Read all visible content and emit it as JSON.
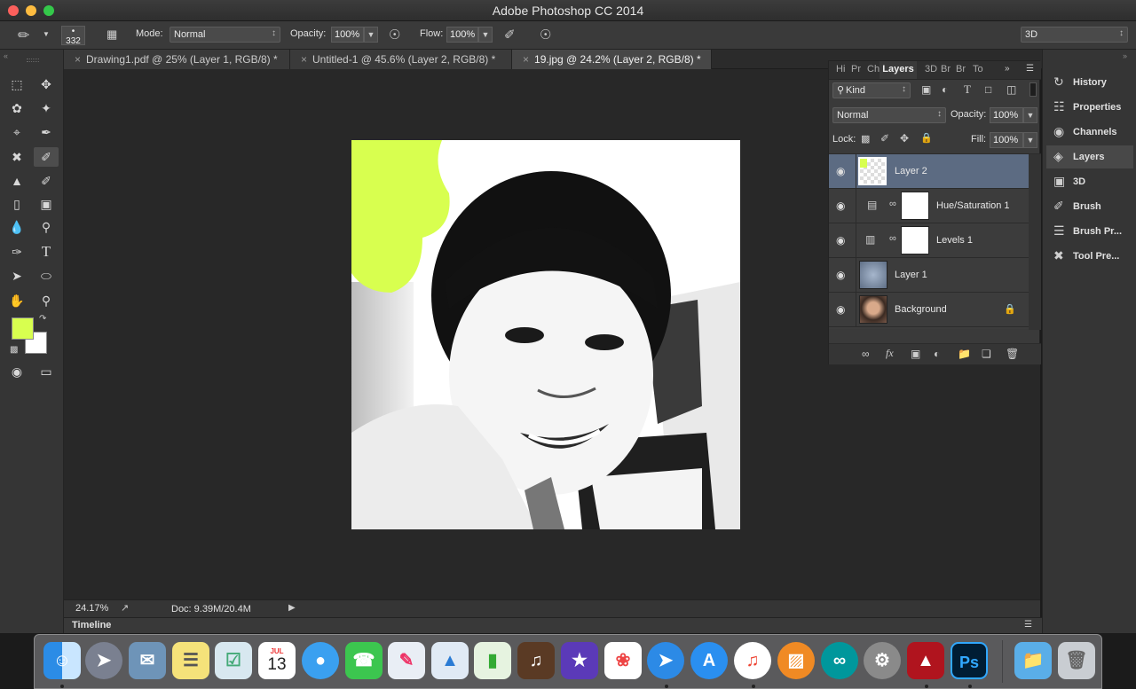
{
  "app": {
    "title": "Adobe Photoshop CC 2014"
  },
  "options": {
    "brush_size": "332",
    "mode_label": "Mode:",
    "mode_value": "Normal",
    "opacity_label": "Opacity:",
    "opacity_value": "100%",
    "flow_label": "Flow:",
    "flow_value": "100%",
    "workspace": "3D"
  },
  "tabs": [
    {
      "label": "Drawing1.pdf @ 25% (Layer 1, RGB/8) *"
    },
    {
      "label": "Untitled-1 @ 45.6% (Layer 2, RGB/8) *"
    },
    {
      "label": "19.jpg @ 24.2% (Layer 2, RGB/8) *"
    }
  ],
  "colors": {
    "foreground": "#d8ff4f",
    "background": "#ffffff",
    "selection": "#5c6b82"
  },
  "status": {
    "zoom": "24.17%",
    "doc": "Doc: 9.39M/20.4M"
  },
  "timeline": {
    "label": "Timeline"
  },
  "layers_panel": {
    "tabs": [
      "Hi",
      "Pr",
      "Ch",
      "Layers",
      "3D",
      "Br",
      "Br",
      "To"
    ],
    "filter": "Kind",
    "blend_mode": "Normal",
    "opacity_label": "Opacity:",
    "opacity_value": "100%",
    "lock_label": "Lock:",
    "fill_label": "Fill:",
    "fill_value": "100%",
    "layers": [
      {
        "name": "Layer 2",
        "selected": true
      },
      {
        "name": "Hue/Saturation 1"
      },
      {
        "name": "Levels 1"
      },
      {
        "name": "Layer 1"
      },
      {
        "name": "Background",
        "locked": true
      }
    ]
  },
  "side_panels": [
    "History",
    "Properties",
    "Channels",
    "Layers",
    "3D",
    "Brush",
    "Brush Pr...",
    "Tool Pre..."
  ],
  "dock": {
    "calendar_month": "JUL",
    "calendar_day": "13",
    "ps_label": "Ps"
  }
}
